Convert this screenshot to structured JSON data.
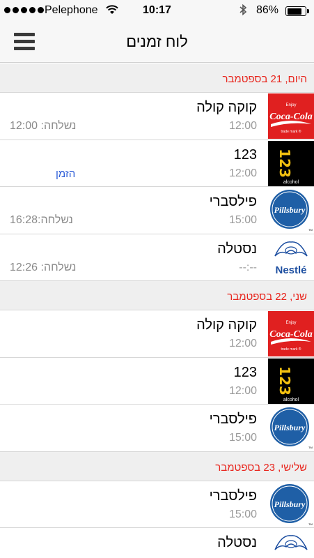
{
  "status": {
    "carrier": "Pelephone",
    "time": "10:17",
    "battery": "86%",
    "battery_level": 0.86
  },
  "nav": {
    "title": "לוח זמנים"
  },
  "sections": [
    {
      "label": "היום, 21 בספטמבר",
      "rows": [
        {
          "brand": "coke",
          "name": "קוקה קולה",
          "time": "12:00",
          "sent": "נשלחה: 12:00",
          "order": ""
        },
        {
          "brand": "123",
          "name": "123",
          "time": "12:00",
          "sent": "",
          "order": "הזמן"
        },
        {
          "brand": "pillsbury",
          "name": "פילסברי",
          "time": "15:00",
          "sent": "נשלחה:16:28",
          "order": ""
        },
        {
          "brand": "nestle",
          "name": "נסטלה",
          "time": "--:--",
          "sent": "נשלחה: 12:26",
          "order": ""
        }
      ]
    },
    {
      "label": "שני, 22 בספטמבר",
      "rows": [
        {
          "brand": "coke",
          "name": "קוקה קולה",
          "time": "12:00",
          "sent": "",
          "order": ""
        },
        {
          "brand": "123",
          "name": "123",
          "time": "12:00",
          "sent": "",
          "order": ""
        },
        {
          "brand": "pillsbury",
          "name": "פילסברי",
          "time": "15:00",
          "sent": "",
          "order": ""
        }
      ]
    },
    {
      "label": "שלישי, 23 בספטמבר",
      "rows": [
        {
          "brand": "pillsbury",
          "name": "פילסברי",
          "time": "15:00",
          "sent": "",
          "order": ""
        },
        {
          "brand": "nestle",
          "name": "נסטלה",
          "time": "",
          "sent": "",
          "order": ""
        }
      ]
    }
  ],
  "logos": {
    "coke": {
      "top": "Enjoy",
      "main": "Coca-Cola",
      "bottom": "trade mark ®"
    },
    "123": {
      "main": "123",
      "sub": "alcohol"
    },
    "pillsbury": {
      "main": "Pillsbury",
      "tm": "TM"
    },
    "nestle": {
      "main": "Nestlé"
    }
  },
  "colors": {
    "section_label": "#e8251d",
    "order_link": "#2a5bd7",
    "coke_red": "#e02020",
    "pillsbury_blue": "#1f5fa6",
    "nestle_blue": "#1c4ea0"
  },
  "icons": {
    "menu": "hamburger-icon",
    "wifi": "wifi-icon",
    "bluetooth": "bluetooth-icon",
    "battery": "battery-icon"
  }
}
